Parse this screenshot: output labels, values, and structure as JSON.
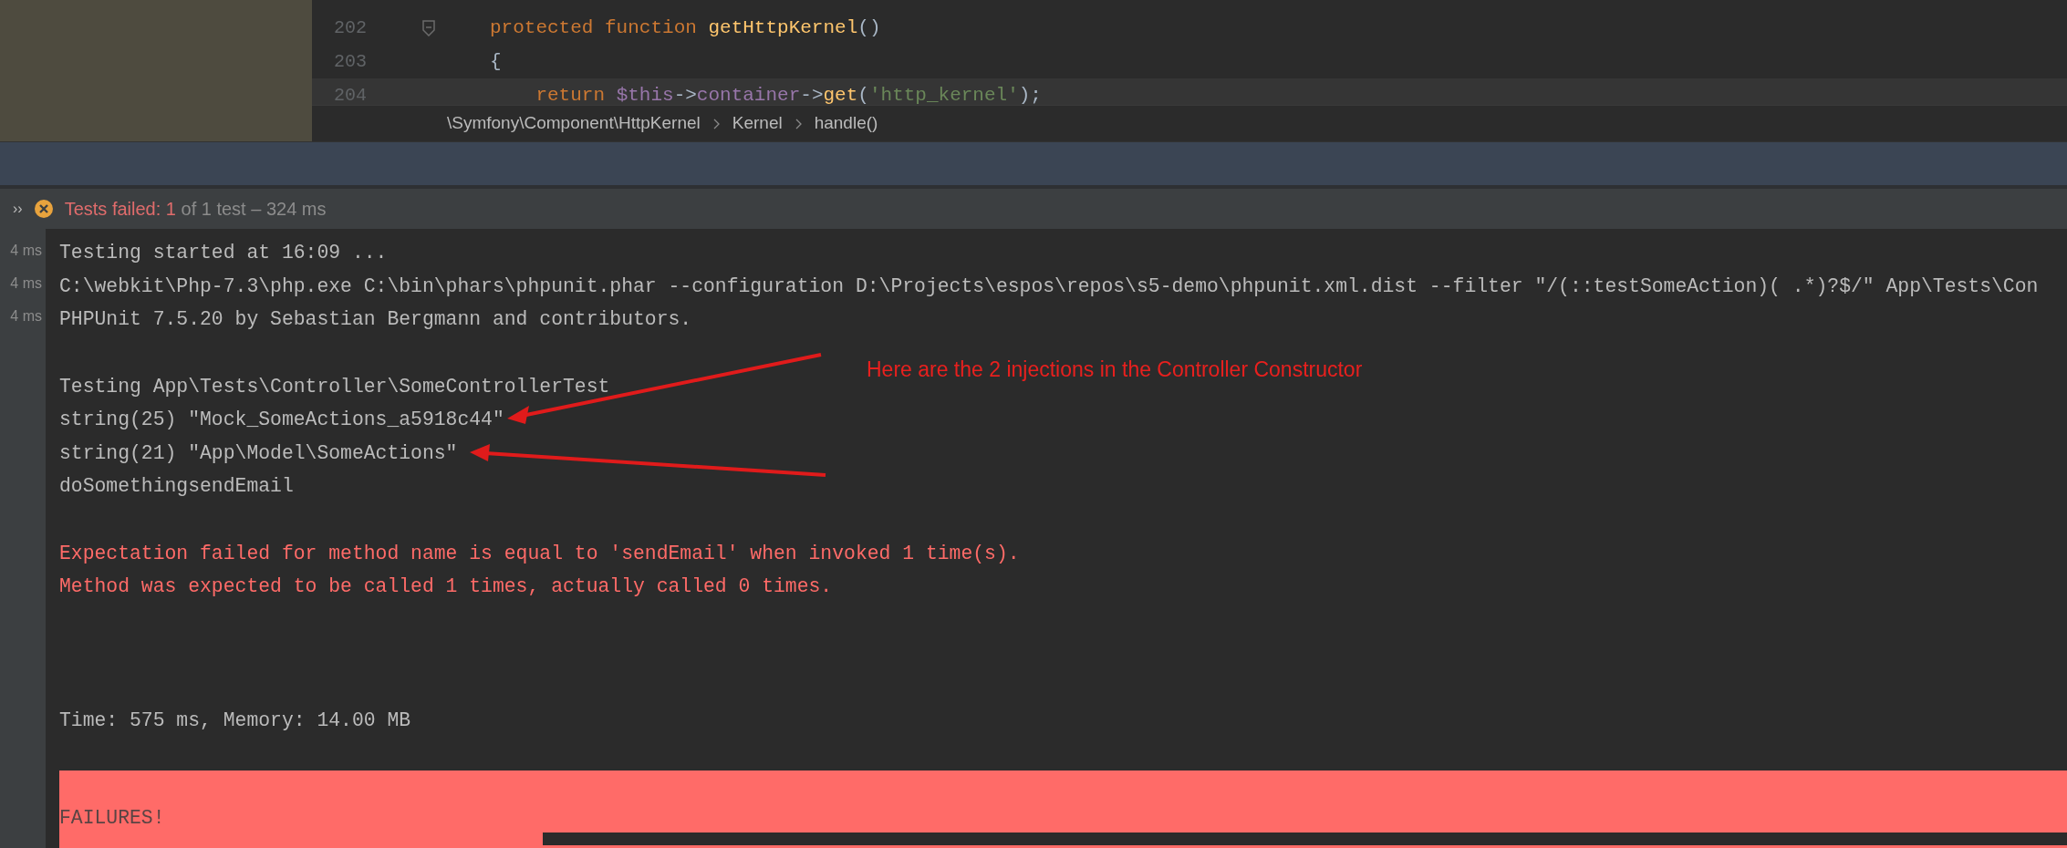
{
  "editor": {
    "lines": [
      {
        "number": "202",
        "fold_marker": true,
        "tokens": [
          {
            "kind": "keyword",
            "text": "protected function "
          },
          {
            "kind": "function",
            "text": "getHttpKernel"
          },
          {
            "kind": "plain",
            "text": "()"
          }
        ]
      },
      {
        "number": "203",
        "tokens": [
          {
            "kind": "plain",
            "text": "{"
          }
        ]
      },
      {
        "number": "204",
        "current": true,
        "tokens": [
          {
            "kind": "keyword",
            "text": "    return "
          },
          {
            "kind": "variable",
            "text": "$this"
          },
          {
            "kind": "plain",
            "text": "->"
          },
          {
            "kind": "variable",
            "text": "container"
          },
          {
            "kind": "plain",
            "text": "->"
          },
          {
            "kind": "function",
            "text": "get"
          },
          {
            "kind": "plain",
            "text": "("
          },
          {
            "kind": "string",
            "text": "'http_kernel'"
          },
          {
            "kind": "plain",
            "text": ");"
          }
        ]
      }
    ],
    "breadcrumb": [
      "\\Symfony\\Component\\HttpKernel",
      "Kernel",
      "handle()"
    ]
  },
  "test_bar": {
    "toggle": "››",
    "label": "Tests failed: ",
    "failed": "1",
    "summary": " of 1 test – 324 ms"
  },
  "durations": [
    "4 ms",
    "4 ms",
    "4 ms"
  ],
  "console": [
    {
      "kind": "normal",
      "text": "Testing started at 16:09 ..."
    },
    {
      "kind": "normal",
      "text": "C:\\webkit\\Php-7.3\\php.exe C:\\bin\\phars\\phpunit.phar --configuration D:\\Projects\\espos\\repos\\s5-demo\\phpunit.xml.dist --filter \"/(::testSomeAction)( .*)?$/\" App\\Tests\\Con"
    },
    {
      "kind": "normal",
      "text": "PHPUnit 7.5.20 by Sebastian Bergmann and contributors."
    },
    {
      "kind": "blank"
    },
    {
      "kind": "normal",
      "text": "Testing App\\Tests\\Controller\\SomeControllerTest"
    },
    {
      "kind": "normal",
      "text": "string(25) \"Mock_SomeActions_a5918c44\""
    },
    {
      "kind": "normal",
      "text": "string(21) \"App\\Model\\SomeActions\""
    },
    {
      "kind": "normal",
      "text": "doSomethingsendEmail"
    },
    {
      "kind": "blank"
    },
    {
      "kind": "error",
      "text": "Expectation failed for method name is equal to 'sendEmail' when invoked 1 time(s)."
    },
    {
      "kind": "error",
      "text": "Method was expected to be called 1 times, actually called 0 times."
    },
    {
      "kind": "blank"
    },
    {
      "kind": "blank"
    },
    {
      "kind": "blank"
    },
    {
      "kind": "normal",
      "text": "Time: 575 ms, Memory: 14.00 MB"
    },
    {
      "kind": "blank"
    },
    {
      "kind": "failure",
      "text": "FAILURES!"
    }
  ],
  "annotation": {
    "text": "Here are the 2 injections in the Controller Constructor"
  }
}
